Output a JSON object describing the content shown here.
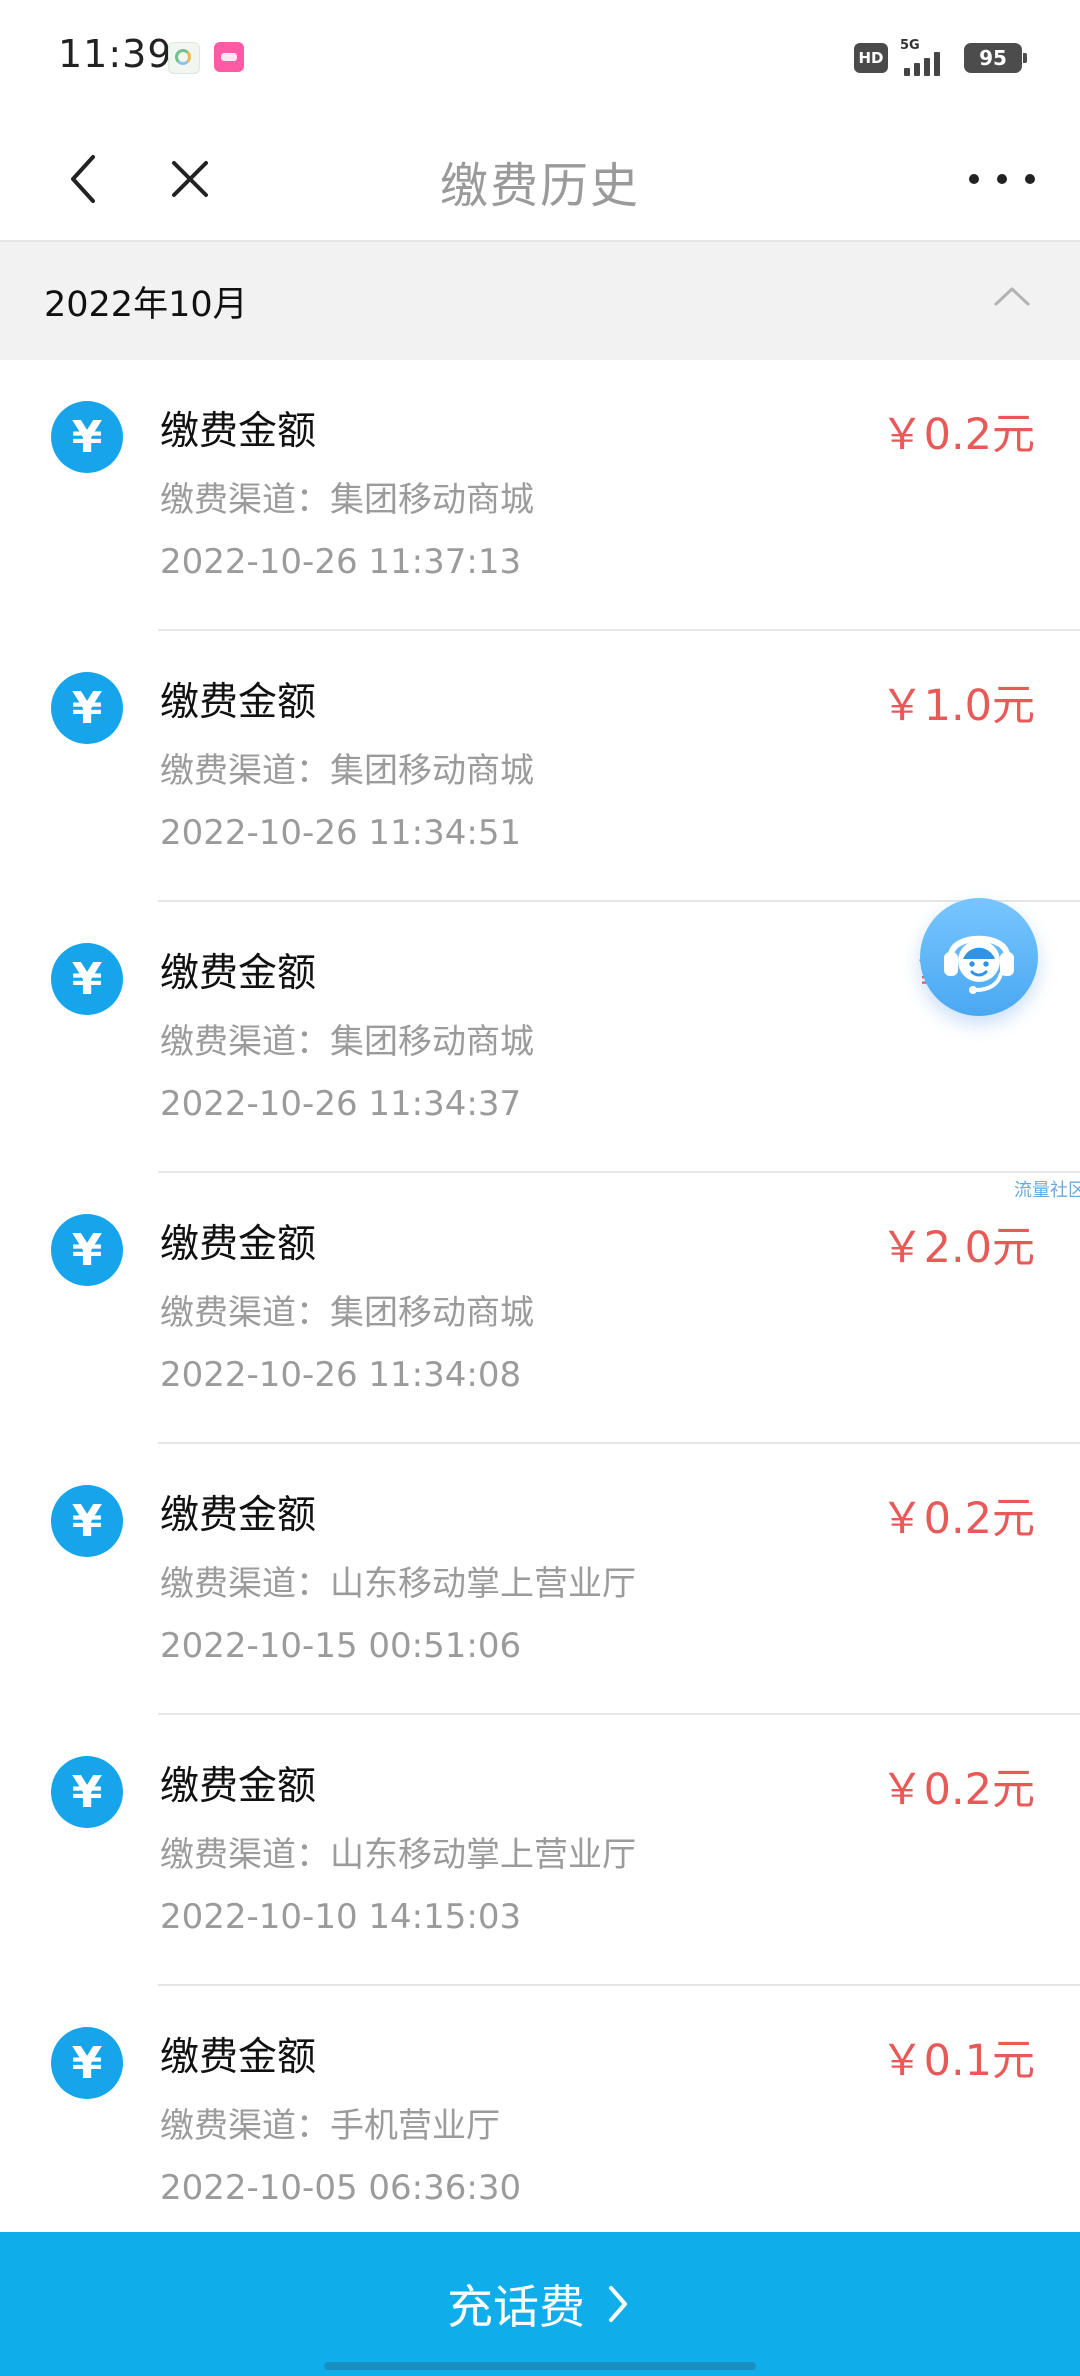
{
  "status_bar": {
    "time": "11:39",
    "hd": "HD",
    "network": "5G",
    "battery": "95"
  },
  "top_nav": {
    "title": "缴费历史",
    "icons": {
      "back": "chevron-left-icon",
      "close": "close-icon",
      "more": "more-horizontal-icon"
    }
  },
  "month": {
    "title": "2022年10月",
    "toggle_icon": "chevron-up-icon"
  },
  "records": [
    {
      "label": "缴费金额",
      "channel": "缴费渠道：集团移动商城",
      "time": "2022-10-26 11:37:13",
      "amount": "￥0.2元"
    },
    {
      "label": "缴费金额",
      "channel": "缴费渠道：集团移动商城",
      "time": "2022-10-26 11:34:51",
      "amount": "￥1.0元"
    },
    {
      "label": "缴费金额",
      "channel": "缴费渠道：集团移动商城",
      "time": "2022-10-26 11:34:37",
      "amount": "￥"
    },
    {
      "label": "缴费金额",
      "channel": "缴费渠道：集团移动商城",
      "time": "2022-10-26 11:34:08",
      "amount": "￥2.0元"
    },
    {
      "label": "缴费金额",
      "channel": "缴费渠道：山东移动掌上营业厅",
      "time": "2022-10-15 00:51:06",
      "amount": "￥0.2元"
    },
    {
      "label": "缴费金额",
      "channel": "缴费渠道：山东移动掌上营业厅",
      "time": "2022-10-10 14:15:03",
      "amount": "￥0.2元"
    },
    {
      "label": "缴费金额",
      "channel": "缴费渠道：手机营业厅",
      "time": "2022-10-05 06:36:30",
      "amount": "￥0.1元"
    }
  ],
  "assistant": {
    "icon": "customer-service-icon",
    "watermark": "流量社区"
  },
  "recharge": {
    "label": "充话费",
    "icon": "chevron-right-icon"
  },
  "colors": {
    "primary": "#0faeea",
    "amount": "#e85a58",
    "list_icon": "#16a5ea",
    "title_gray": "#9a9a9a"
  }
}
